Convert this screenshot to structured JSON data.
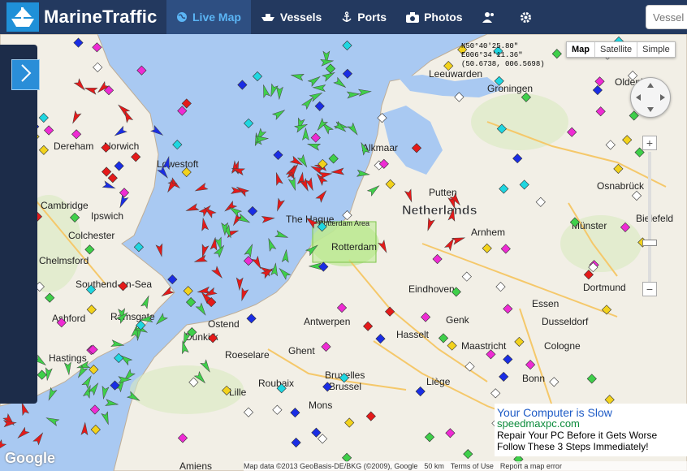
{
  "brand": {
    "name": "MarineTraffic"
  },
  "nav": {
    "live_map": "Live Map",
    "vessels": "Vessels",
    "ports": "Ports",
    "photos": "Photos"
  },
  "search": {
    "placeholder": "Vessel"
  },
  "map_type": {
    "map": "Map",
    "satellite": "Satellite",
    "simple": "Simple"
  },
  "coords": {
    "lat": "N50°40'25.80\"",
    "lon": "E006°34'11.36\"",
    "decimal": "(50.6738, 006.5698)"
  },
  "zoom": {
    "plus": "+",
    "minus": "−"
  },
  "ad": {
    "title": "Your Computer is Slow",
    "url": "speedmaxpc.com",
    "line1": "Repair Your PC Before it Gets Worse",
    "line2": "Follow These 3 Steps Immediately!"
  },
  "footer": {
    "map_data": "Map data ©2013 GeoBasis-DE/BKG (©2009), Google",
    "scale": "50 km",
    "terms": "Terms of Use",
    "report": "Report a map error"
  },
  "google_logo": "Google",
  "map_labels": {
    "netherlands": "Netherlands",
    "rotterdam": "Rotterdam",
    "rotterdam_area": "Rotterdam Area",
    "the_hague": "The Hague",
    "antwerp": "Antwerpen",
    "ghent": "Ghent",
    "brussel": "Brussel",
    "bruxelles": "Bruxelles",
    "liege": "Liège",
    "dusseldorf": "Dusseldorf",
    "essen": "Essen",
    "dortmund": "Dortmund",
    "cologne": "Cologne",
    "bonn": "Bonn",
    "munster": "Münster",
    "bielefeld": "Bielefeld",
    "osnabruck": "Osnabrück",
    "oldenburg": "Oldenburg",
    "groningen": "Groningen",
    "leeuwarden": "Leeuwarden",
    "norwich": "Norwich",
    "ipswich": "Ipswich",
    "cambridge": "Cambridge",
    "colchester": "Colchester",
    "chelmsford": "Chelmsford",
    "southend": "Southend-on-Sea",
    "ramsgate": "Ramsgate",
    "ashford": "Ashford",
    "hastings": "Hastings",
    "dunkirk": "Dunkirk",
    "lille": "Lille",
    "mons": "Mons",
    "roubaix": "Roubaix",
    "eindhoven": "Eindhoven",
    "hasselt": "Hasselt",
    "maastricht": "Maastricht",
    "amiens": "Amiens",
    "lowestoft": "Lowestoft",
    "dereham": "Dereham",
    "alkmaar": "Alkmaar",
    "putten": "Putten",
    "genk": "Genk",
    "roeselare": "Roeselare",
    "ostend": "Ostend",
    "arnhem": "Arnhem"
  },
  "colors": {
    "topbar": "#23395f",
    "sea": "#a9c9f2",
    "land": "#f2efe6",
    "cargo": "#3fcf4a",
    "tanker": "#e41a1a",
    "passenger": "#1a2de4",
    "active_nav": "#5bb5f5"
  }
}
